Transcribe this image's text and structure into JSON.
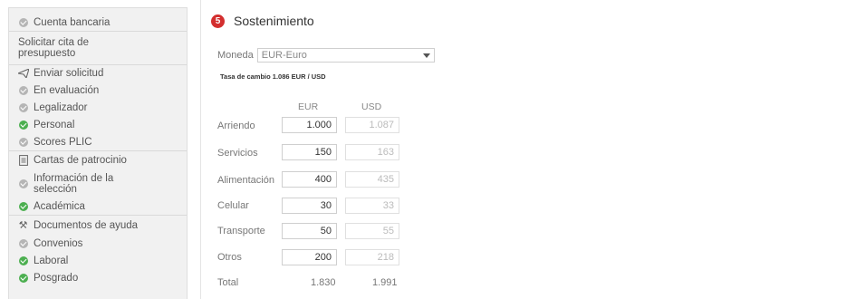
{
  "sidebar": {
    "items": [
      {
        "label": "Cuenta bancaria",
        "icon": "check-circle-gray-icon"
      },
      {
        "label": "Solicitar cita de presupuesto",
        "icon": ""
      },
      {
        "label": "Enviar solicitud",
        "icon": "paper-plane-icon"
      },
      {
        "label": "En evaluación",
        "icon": "check-circle-gray-icon"
      },
      {
        "label": "Legalizador",
        "icon": "check-circle-gray-icon"
      },
      {
        "label": "Personal",
        "icon": "check-circle-green-icon"
      },
      {
        "label": "Scores PLIC",
        "icon": "check-circle-gray-icon"
      },
      {
        "label": "Cartas de patrocinio",
        "icon": "document-icon"
      },
      {
        "label": "Información de la selección",
        "icon": "check-circle-gray-icon"
      },
      {
        "label": "Académica",
        "icon": "check-circle-green-icon"
      },
      {
        "label": "Documentos de ayuda",
        "icon": "tools-icon"
      },
      {
        "label": "Convenios",
        "icon": "check-circle-gray-icon"
      },
      {
        "label": "Laboral",
        "icon": "check-circle-green-icon"
      },
      {
        "label": "Posgrado",
        "icon": "check-circle-green-icon"
      }
    ]
  },
  "section": {
    "step": "5",
    "title": "Sostenimiento"
  },
  "currency": {
    "label": "Moneda",
    "selected": "EUR-Euro"
  },
  "rate_text": "Tasa de cambio 1.086 EUR / USD",
  "table": {
    "col_eur": "EUR",
    "col_usd": "USD",
    "rows": [
      {
        "label": "Arriendo",
        "eur": "1.000",
        "usd": "1.087"
      },
      {
        "label": "Servicios",
        "eur": "150",
        "usd": "163"
      },
      {
        "label": "Alimentación",
        "eur": "400",
        "usd": "435"
      },
      {
        "label": "Celular",
        "eur": "30",
        "usd": "33"
      },
      {
        "label": "Transporte",
        "eur": "50",
        "usd": "55"
      },
      {
        "label": "Otros",
        "eur": "200",
        "usd": "218"
      }
    ],
    "total": {
      "label": "Total",
      "eur": "1.830",
      "usd": "1.991"
    }
  },
  "colors": {
    "accent_red": "#d32f2f",
    "ok_green": "#4caf50",
    "neutral_gray": "#b5b5b5"
  }
}
